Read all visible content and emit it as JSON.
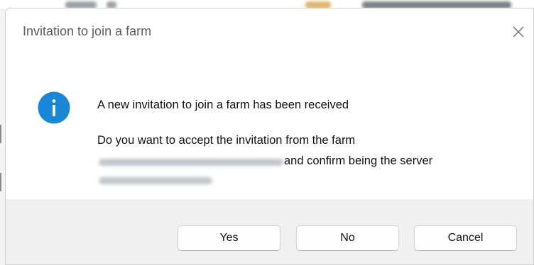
{
  "dialog": {
    "title": "Invitation to join a farm",
    "message_heading": "A new invitation to join a farm has been received",
    "message_line_1": "Do you want to accept the invitation from the farm",
    "message_line_2_suffix": "and confirm being the server"
  },
  "buttons": {
    "yes": "Yes",
    "no": "No",
    "cancel": "Cancel"
  },
  "icons": {
    "dialog_icon": "info-icon",
    "close": "close-icon"
  },
  "colors": {
    "info_icon": "#1a86d8",
    "footer_background": "#f0f0f0",
    "title_text": "#5c5c5c"
  }
}
